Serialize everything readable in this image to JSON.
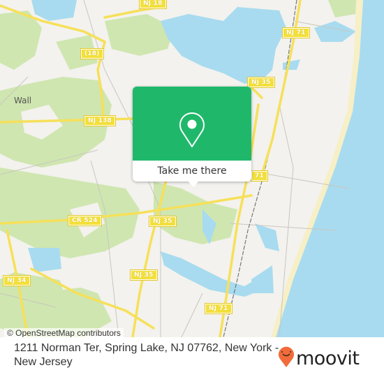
{
  "map": {
    "place_labels": [
      {
        "id": "wall",
        "text": "Wall"
      }
    ],
    "road_shields": [
      {
        "id": "nj18-top",
        "text": "NJ 18"
      },
      {
        "id": "cr18",
        "text": "(18)"
      },
      {
        "id": "nj71-top",
        "text": "NJ 71"
      },
      {
        "id": "nj35-top",
        "text": "NJ 35"
      },
      {
        "id": "nj138",
        "text": "NJ 138"
      },
      {
        "id": "nj71-mid",
        "text": "71"
      },
      {
        "id": "cr524",
        "text": "CR 524"
      },
      {
        "id": "nj35-mid",
        "text": "NJ 35"
      },
      {
        "id": "nj35-low",
        "text": "NJ 35"
      },
      {
        "id": "nj34",
        "text": "NJ 34"
      },
      {
        "id": "nj71-low",
        "text": "NJ 71"
      }
    ],
    "colors": {
      "land": "#f3f2ee",
      "water": "#a8dbef",
      "park": "#cfe6b0",
      "road": "#f6e05a",
      "beach": "#f7efc6",
      "accent": "#1fb86b"
    },
    "attribution": "© OpenStreetMap contributors"
  },
  "popup": {
    "icon": "location-pin-icon",
    "button_label": "Take me there"
  },
  "footer": {
    "address": "1211 Norman Ter, Spring Lake, NJ 07762, New York - New Jersey",
    "brand": "moovit",
    "brand_color": "#f26b3a"
  }
}
